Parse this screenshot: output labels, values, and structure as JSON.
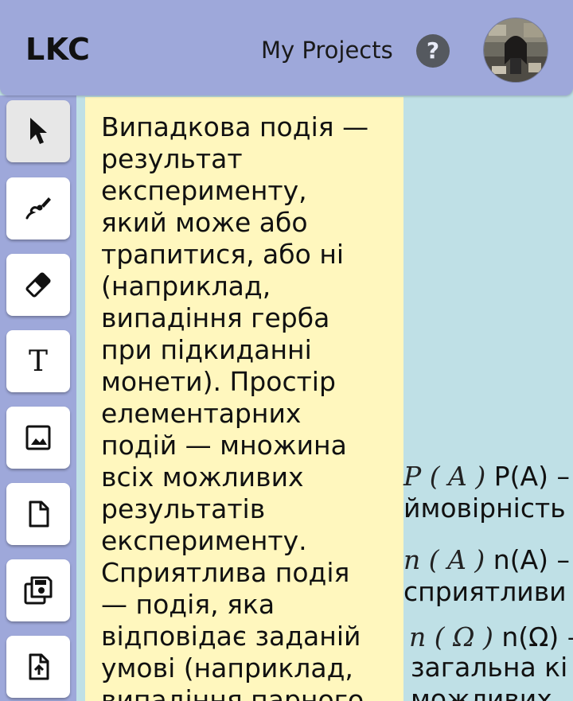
{
  "header": {
    "logo": "LKC",
    "my_projects": "My Projects",
    "help": "?"
  },
  "toolbar": {
    "tools": [
      {
        "name": "select",
        "icon": "cursor-arrow-icon",
        "active": true
      },
      {
        "name": "draw",
        "icon": "brush-icon"
      },
      {
        "name": "erase",
        "icon": "eraser-icon"
      },
      {
        "name": "text",
        "icon": "text-icon",
        "glyph": "T"
      },
      {
        "name": "image",
        "icon": "image-icon"
      },
      {
        "name": "new-page",
        "icon": "file-icon"
      },
      {
        "name": "save",
        "icon": "save-icon"
      },
      {
        "name": "upload",
        "icon": "upload-file-icon"
      }
    ]
  },
  "note": {
    "text": "Випадкова подія —\nрезультат\nексперименту,\nякий може або\nтрапитися, або ні\n(наприклад,\nвипадіння герба\nпри підкиданні\nмонети).  Простір\nелементарних\nподій — множина\nвсіх можливих\nрезультатів\nексперименту.\nСприятлива подія\n— подія, яка\nвідповідає заданій\nумові (наприклад,\nвипадіння парного"
  },
  "canvas": {
    "line1_math": "P ( A )",
    "line1_text": " P(A) –",
    "line2_text": "ймовірність",
    "line3_math": "n ( A )",
    "line3_text": " n(A) –",
    "line4_text": "сприятливи",
    "line5_math": "n ( Ω )",
    "line5_text": " n(Ω) –",
    "line6_text": "загальна кі",
    "line7_text": "можливих"
  },
  "colors": {
    "topbar": "#9ea8da",
    "canvas": "#bfe0e6",
    "note": "#fff7be",
    "help_bg": "#55595f"
  }
}
